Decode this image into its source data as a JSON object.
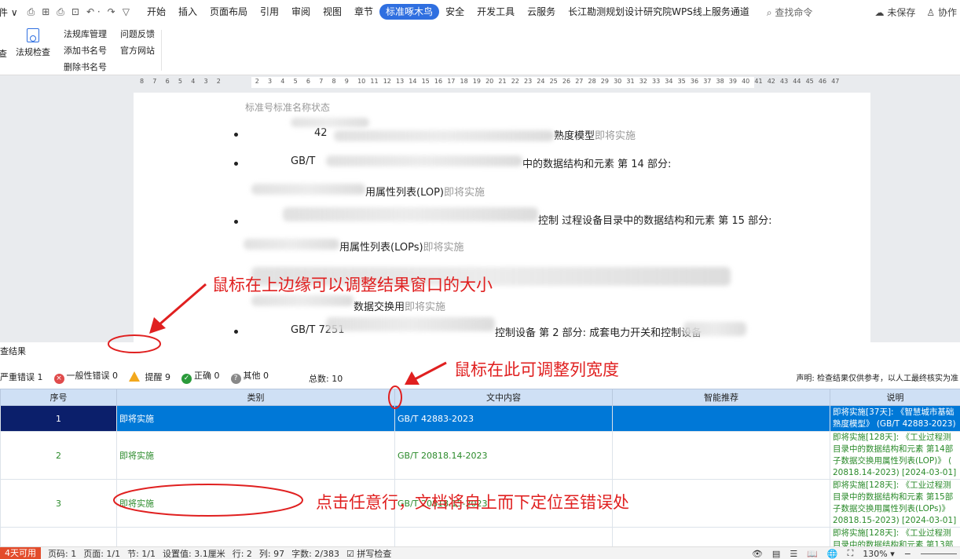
{
  "menubar": {
    "file": "件 ∨",
    "quick_access": [
      "⎙",
      "⊞",
      "⎙",
      "⊡",
      "↶ ·",
      "↷",
      "▽"
    ],
    "items": [
      {
        "label": "开始"
      },
      {
        "label": "插入"
      },
      {
        "label": "页面布局"
      },
      {
        "label": "引用"
      },
      {
        "label": "审阅"
      },
      {
        "label": "视图"
      },
      {
        "label": "章节"
      },
      {
        "label": "标准啄木鸟",
        "active": true
      },
      {
        "label": "安全"
      },
      {
        "label": "开发工具"
      },
      {
        "label": "云服务"
      },
      {
        "label": "长江勘测规划设计研究院WPS线上服务通道"
      }
    ],
    "search": "查找命令",
    "unsaved": "未保存",
    "collab": "协作"
  },
  "ribbon": {
    "left_cut": "查",
    "check_label": "法规检查",
    "col1": [
      "法规库管理",
      "添加书名号",
      "删除书名号"
    ],
    "col2": [
      "问题反馈",
      "官方网站"
    ]
  },
  "ruler": {
    "labels": [
      "8",
      "7",
      "6",
      "5",
      "4",
      "3",
      "2",
      "",
      "",
      "2",
      "3",
      "4",
      "5",
      "6",
      "7",
      "8",
      "9",
      "10",
      "11",
      "12",
      "13",
      "14",
      "15",
      "16",
      "17",
      "18",
      "19",
      "20",
      "21",
      "22",
      "23",
      "24",
      "25",
      "26",
      "27",
      "28",
      "29",
      "30",
      "31",
      "32",
      "33",
      "34",
      "35",
      "36",
      "37",
      "38",
      "39",
      "40",
      "41",
      "42",
      "43",
      "44",
      "45",
      "46",
      "47"
    ]
  },
  "document": {
    "header": "标准号标准名称状态",
    "lines": [
      {
        "pre": "42",
        "text": "熟度模型",
        "status": "即将实施"
      },
      {
        "pre": "GB/T",
        "text": "中的数据结构和元素 第 14 部分:"
      },
      {
        "text": "用属性列表(LOP)",
        "status": "即将实施"
      },
      {
        "text": "控制 过程设备目录中的数据结构和元素 第 15 部分:"
      },
      {
        "text": "用属性列表(LOPs)",
        "status": "即将实施"
      },
      {
        "text": "数据交换用",
        "status": "即将实施"
      },
      {
        "pre": "GB/T 7251",
        "text": "控制设备 第 2 部分: 成套电力开关和控制设备"
      }
    ]
  },
  "annotations": {
    "top_edge": "鼠标在上边缘可以调整结果窗口的大小",
    "col_width": "鼠标在此可调整列宽度",
    "click_row": "点击任意行，文档将自上而下定位至错误处"
  },
  "results": {
    "title": "查结果",
    "stats": {
      "severe": "严重错误 1",
      "general": "一般性错误 0",
      "hint": "提醒 9",
      "correct": "正确 0",
      "other": "其他 0"
    },
    "total": "总数: 10",
    "note": "声明: 检查结果仅供参考，以人工最终核实为准",
    "columns": [
      "序号",
      "类别",
      "文中内容",
      "智能推荐",
      "说明"
    ],
    "rows": [
      {
        "seq": "1",
        "category": "即将实施",
        "content": "GB/T 42883-2023",
        "recommend": "",
        "desc": [
          "即将实施[37天]: 《智慧城市基础",
          "熟度模型》 (GB/T 42883-2023)"
        ]
      },
      {
        "seq": "2",
        "category": "即将实施",
        "content": "GB/T 20818.14-2023",
        "recommend": "",
        "desc": [
          "即将实施[128天]: 《工业过程测",
          "目录中的数据结构和元素 第14部",
          "子数据交换用属性列表(LOP)》 (",
          "20818.14-2023) [2024-03-01]"
        ]
      },
      {
        "seq": "3",
        "category": "即将实施",
        "content": "GB/T 20818.15-2023",
        "recommend": "",
        "desc": [
          "即将实施[128天]: 《工业过程测",
          "目录中的数据结构和元素 第15部",
          "子数据交换用属性列表(LOPs)》",
          "20818.15-2023) [2024-03-01]"
        ]
      },
      {
        "seq": "",
        "category": "",
        "content": "",
        "recommend": "",
        "desc": [
          "即将实施[128天]: 《工业过程测",
          "目录中的数据结构和元素 第13部"
        ]
      }
    ]
  },
  "statusbar": {
    "trial": "4天可用",
    "page_code": "页码: 1",
    "page": "页面: 1/1",
    "section": "节: 1/1",
    "setting": "设置值: 3.1厘米",
    "row": "行: 2",
    "col": "列: 97",
    "words": "字数: 2/383",
    "spell": "拼写检查",
    "zoom": "130%"
  },
  "colors": {
    "accent": "#2f6fe0",
    "annotation": "#e02020",
    "selected_row": "#0078d7",
    "status_green": "#2a8a2a"
  }
}
